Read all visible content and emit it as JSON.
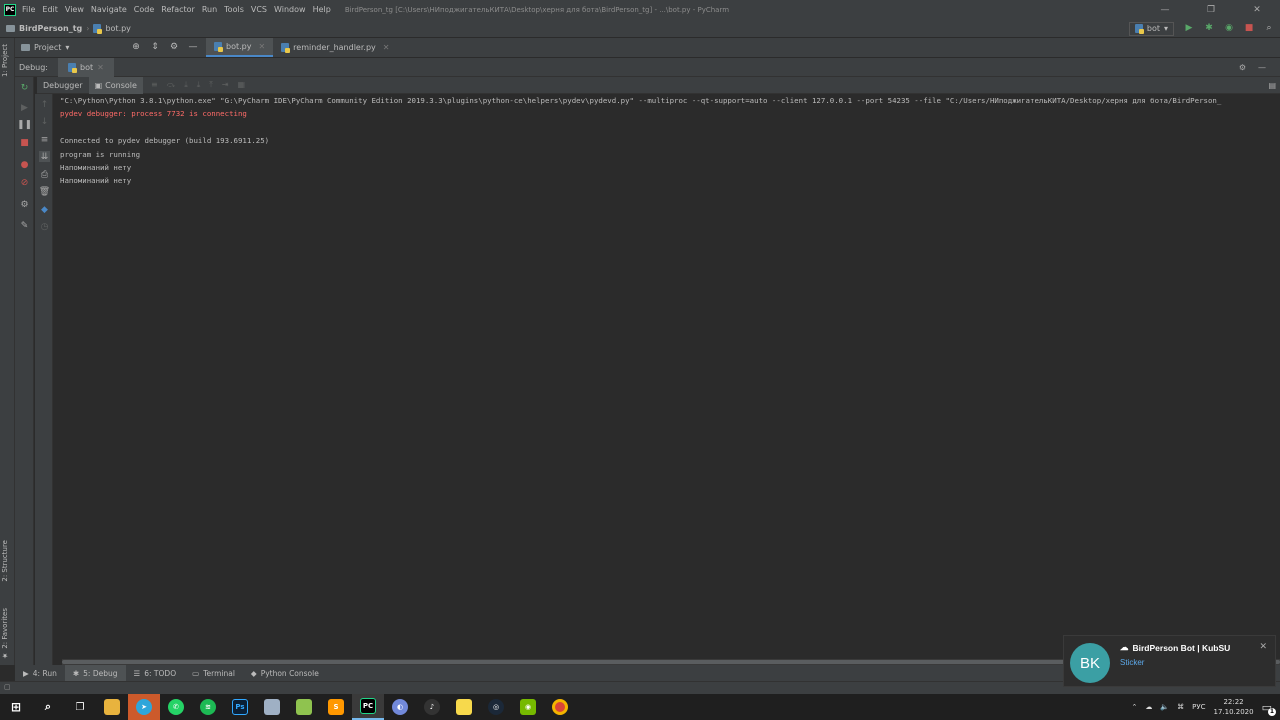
{
  "titlebar": {
    "menu": [
      "File",
      "Edit",
      "View",
      "Navigate",
      "Code",
      "Refactor",
      "Run",
      "Tools",
      "VCS",
      "Window",
      "Help"
    ],
    "window_title": "BirdPerson_tg [C:\\Users\\НИподжигательКИТА\\Desktop\\херня для бота\\BirdPerson_tg] - ...\\bot.py - PyCharm",
    "controls": [
      "—",
      "❐",
      "✕"
    ]
  },
  "navbar": {
    "project": "BirdPerson_tg",
    "file": "bot.py",
    "run_config": "bot"
  },
  "project_panel": {
    "label": "Project"
  },
  "editor_tabs": [
    {
      "label": "bot.py",
      "active": true
    },
    {
      "label": "reminder_handler.py",
      "active": false
    }
  ],
  "side_tabs": {
    "project": "1: Project",
    "structure": "2: Structure",
    "favorites": "2: Favorites"
  },
  "debug": {
    "label": "Debug:",
    "session": "bot",
    "tabs": [
      {
        "label": "Debugger"
      },
      {
        "label": "Console"
      }
    ]
  },
  "console": {
    "lines": [
      {
        "text": "\"C:\\Python\\Python 3.8.1\\python.exe\" \"G:\\PyCharm IDE\\PyCharm Community Edition 2019.3.3\\plugins\\python-ce\\helpers\\pydev\\pydevd.py\" --multiproc --qt-support=auto --client 127.0.0.1 --port 54235 --file \"C:/Users/НИподжигательКИТА/Desktop/херня для бота/BirdPerson_",
        "type": "normal"
      },
      {
        "text": "pydev debugger: process 7732 is connecting",
        "type": "error"
      },
      {
        "text": "",
        "type": "normal"
      },
      {
        "text": "Connected to pydev debugger (build 193.6911.25)",
        "type": "normal"
      },
      {
        "text": "program is running",
        "type": "normal"
      },
      {
        "text": "Напоминаний нету",
        "type": "normal"
      },
      {
        "text": "Напоминаний нету",
        "type": "normal"
      }
    ]
  },
  "bottom_tabs": [
    {
      "label": "4: Run",
      "active": false
    },
    {
      "label": "5: Debug",
      "active": true
    },
    {
      "label": "6: TODO",
      "active": false
    },
    {
      "label": "Terminal",
      "active": false
    },
    {
      "label": "Python Console",
      "active": false
    }
  ],
  "taskbar": {
    "apps": [
      "start",
      "search",
      "task-view",
      "explorer",
      "telegram",
      "whatsapp",
      "spotify",
      "photoshop",
      "notepad",
      "notepadpp",
      "sublime",
      "pycharm",
      "discord",
      "yandex-music",
      "sticky-notes",
      "steam",
      "nvidia",
      "chrome"
    ],
    "tray": {
      "lang": "РУС",
      "time": "22:22",
      "date": "17.10.2020",
      "notification_count": "1"
    }
  },
  "toast": {
    "avatar": "BK",
    "title": "BirdPerson Bot | KubSU",
    "message": "Sticker"
  },
  "colors": {
    "accent": "#4a88c7",
    "error": "#ff6b68",
    "bg": "#2b2b2b",
    "panel": "#3c3f41"
  }
}
